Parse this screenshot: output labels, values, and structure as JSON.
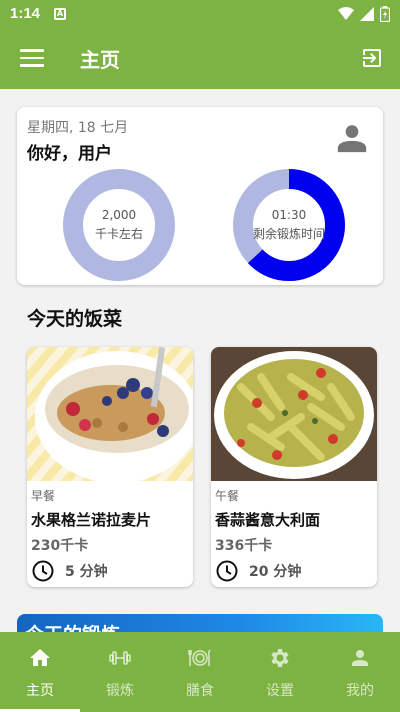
{
  "status_bar": {
    "time": "1:14",
    "notification_icon": "A"
  },
  "app_bar": {
    "title": "主页",
    "menu_icon": "menu-icon",
    "action_icon": "logout-icon"
  },
  "summary": {
    "date": "星期四, 18 七月",
    "greeting": "你好，用户",
    "calories": {
      "value": "2,000",
      "label": "千卡左右",
      "progress": 1.0,
      "color": "#b0b8e2"
    },
    "time_left": {
      "value": "01:30",
      "label": "剩余锻炼时间",
      "progress": 0.63,
      "color": "#0000ee",
      "track_color": "#b0b8e2"
    }
  },
  "meals_section": {
    "title": "今天的饭菜",
    "meals": [
      {
        "type": "早餐",
        "name": "水果格兰诺拉麦片",
        "calories": "230千卡",
        "duration": "5 分钟"
      },
      {
        "type": "午餐",
        "name": "香蒜酱意大利面",
        "calories": "336千卡",
        "duration": "20 分钟"
      }
    ]
  },
  "workout_section": {
    "title": "今天的锻炼"
  },
  "bottom_nav": [
    {
      "label": "主页",
      "icon": "home-icon",
      "active": true
    },
    {
      "label": "锻炼",
      "icon": "dumbbell-icon",
      "active": false
    },
    {
      "label": "膳食",
      "icon": "meal-icon",
      "active": false
    },
    {
      "label": "设置",
      "icon": "gear-icon",
      "active": false
    },
    {
      "label": "我的",
      "icon": "person-icon",
      "active": false
    }
  ],
  "colors": {
    "primary": "#7cb342",
    "ring_track": "#b0b8e2",
    "ring_progress": "#0000ee"
  }
}
